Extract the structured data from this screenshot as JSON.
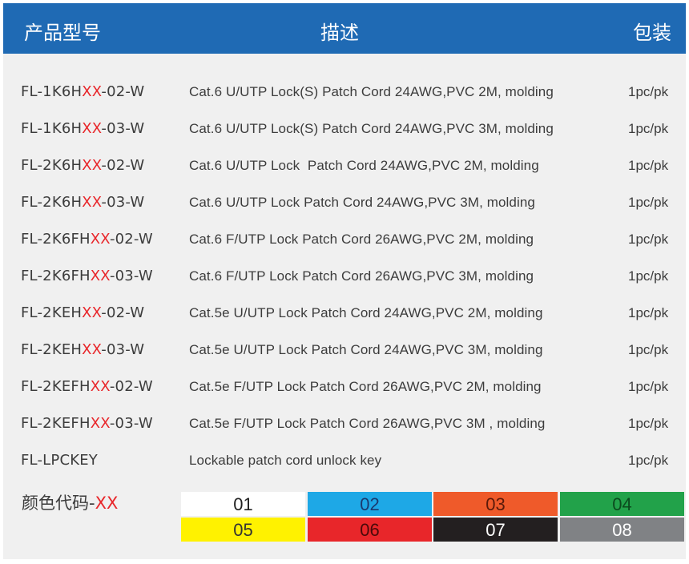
{
  "header": {
    "model": "产品型号",
    "description": "描述",
    "packing": "包装"
  },
  "rows": [
    {
      "prefix": "FL-1K6H",
      "xx": "XX",
      "suffix": "-02-W",
      "description": "Cat.6 U/UTP Lock(S) Patch Cord 24AWG,PVC 2M, molding",
      "pack": "1pc/pk"
    },
    {
      "prefix": "FL-1K6H",
      "xx": "XX",
      "suffix": "-03-W",
      "description": "Cat.6 U/UTP Lock(S) Patch Cord 24AWG,PVC 3M, molding",
      "pack": "1pc/pk"
    },
    {
      "prefix": "FL-2K6H",
      "xx": "XX",
      "suffix": "-02-W",
      "description": "Cat.6 U/UTP Lock  Patch Cord 24AWG,PVC 2M, molding",
      "pack": "1pc/pk"
    },
    {
      "prefix": "FL-2K6H",
      "xx": "XX",
      "suffix": "-03-W",
      "description": "Cat.6 U/UTP Lock Patch Cord 24AWG,PVC 3M, molding",
      "pack": "1pc/pk"
    },
    {
      "prefix": "FL-2K6FH",
      "xx": "XX",
      "suffix": "-02-W",
      "description": "Cat.6 F/UTP Lock Patch Cord 26AWG,PVC 2M, molding",
      "pack": "1pc/pk"
    },
    {
      "prefix": "FL-2K6FH",
      "xx": "XX",
      "suffix": "-03-W",
      "description": "Cat.6 F/UTP Lock Patch Cord 26AWG,PVC 3M, molding",
      "pack": "1pc/pk"
    },
    {
      "prefix": "FL-2KEH",
      "xx": "XX",
      "suffix": "-02-W",
      "description": "Cat.5e U/UTP Lock Patch Cord 24AWG,PVC 2M, molding",
      "pack": "1pc/pk"
    },
    {
      "prefix": "FL-2KEH",
      "xx": "XX",
      "suffix": "-03-W",
      "description": "Cat.5e U/UTP Lock Patch Cord 24AWG,PVC 3M, molding",
      "pack": "1pc/pk"
    },
    {
      "prefix": "FL-2KEFH",
      "xx": "XX",
      "suffix": "-02-W",
      "description": "Cat.5e F/UTP Lock Patch Cord 26AWG,PVC 2M, molding",
      "pack": "1pc/pk"
    },
    {
      "prefix": "FL-2KEFH",
      "xx": "XX",
      "suffix": "-03-W",
      "description": "Cat.5e F/UTP Lock Patch Cord 26AWG,PVC 3M , molding",
      "pack": "1pc/pk"
    },
    {
      "prefix": "FL-LPCKEY",
      "xx": "",
      "suffix": "",
      "description": "Lockable patch cord unlock key",
      "pack": "1pc/pk"
    }
  ],
  "color_code": {
    "label": "颜色代码-",
    "xx": "XX",
    "swatches": [
      {
        "code": "01",
        "bg": "#ffffff",
        "fg": "#222222"
      },
      {
        "code": "02",
        "bg": "#1ea8e6",
        "fg": "#1b3a6e"
      },
      {
        "code": "03",
        "bg": "#ef5a2a",
        "fg": "#5a1a0a"
      },
      {
        "code": "04",
        "bg": "#22a24a",
        "fg": "#0c4a1e"
      },
      {
        "code": "05",
        "bg": "#fff200",
        "fg": "#333333"
      },
      {
        "code": "06",
        "bg": "#e8262a",
        "fg": "#4a0a0a"
      },
      {
        "code": "07",
        "bg": "#231f20",
        "fg": "#ffffff"
      },
      {
        "code": "08",
        "bg": "#808285",
        "fg": "#ffffff"
      }
    ]
  },
  "colors": {
    "header_bg": "#1f6ab4",
    "accent_red": "#e8262a",
    "panel_bg": "#f0f0f0"
  }
}
